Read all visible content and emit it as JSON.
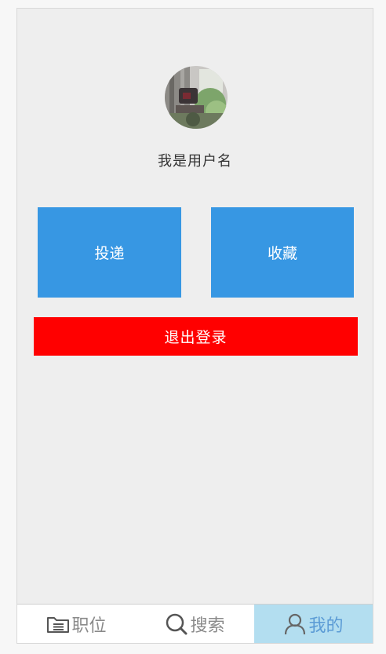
{
  "profile": {
    "username": "我是用户名",
    "avatar_icon": "avatar-photo"
  },
  "actions": {
    "deliver_label": "投递",
    "favorites_label": "收藏",
    "logout_label": "退出登录"
  },
  "tabs": [
    {
      "label": "职位",
      "icon": "folder-document-icon",
      "active": false
    },
    {
      "label": "搜索",
      "icon": "search-icon",
      "active": false
    },
    {
      "label": "我的",
      "icon": "person-icon",
      "active": true
    }
  ],
  "colors": {
    "tile": "#3797e3",
    "logout": "#ff0000",
    "tab_active_bg": "#b3def0",
    "tab_active_text": "#5b9bd5",
    "tab_inactive_text": "#8a8a8a"
  }
}
